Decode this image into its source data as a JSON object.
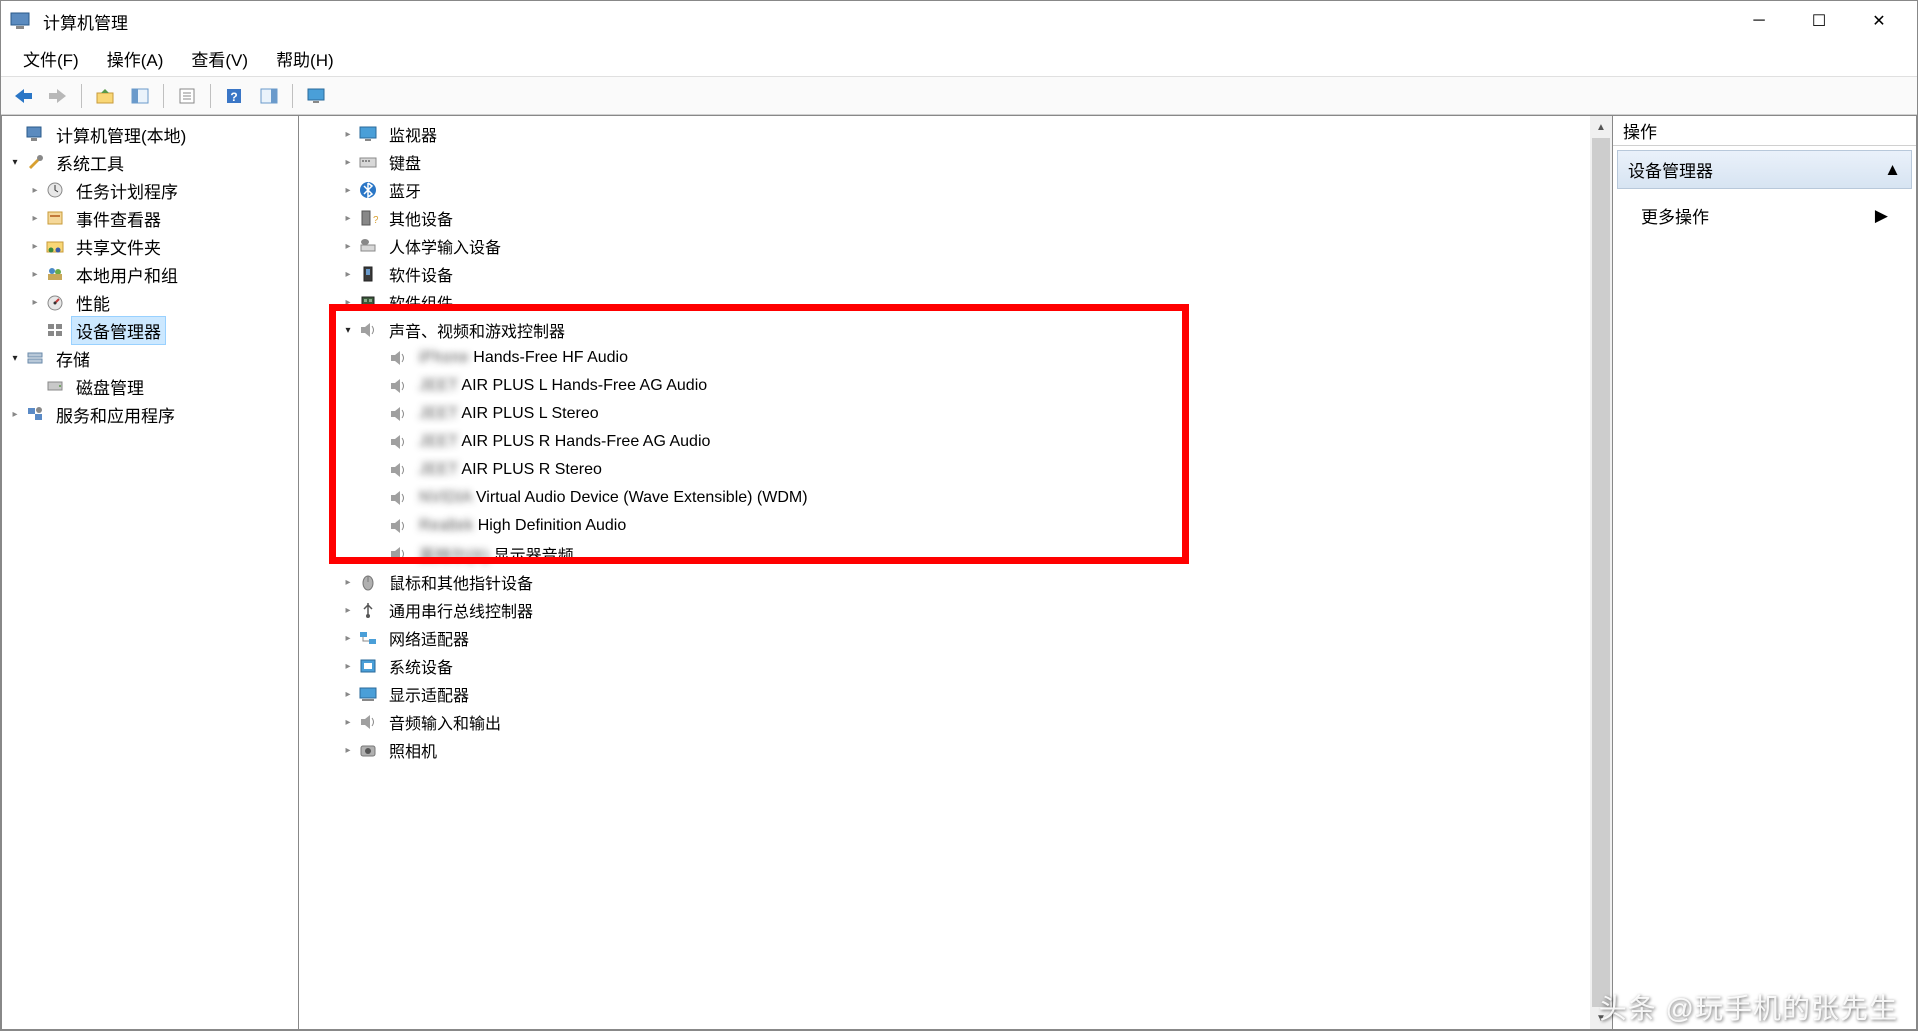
{
  "window": {
    "title": "计算机管理"
  },
  "menu": {
    "file": "文件(F)",
    "action": "操作(A)",
    "view": "查看(V)",
    "help": "帮助(H)"
  },
  "left_tree": {
    "root": "计算机管理(本地)",
    "system_tools": "系统工具",
    "task_scheduler": "任务计划程序",
    "event_viewer": "事件查看器",
    "shared_folders": "共享文件夹",
    "local_users": "本地用户和组",
    "performance": "性能",
    "device_manager": "设备管理器",
    "storage": "存储",
    "disk_management": "磁盘管理",
    "services_apps": "服务和应用程序"
  },
  "devices": {
    "monitor": "监视器",
    "keyboard": "键盘",
    "bluetooth": "蓝牙",
    "other_devices": "其他设备",
    "hid": "人体学输入设备",
    "software_devices": "软件设备",
    "software_components": "软件组件",
    "sound_video_game": "声音、视频和游戏控制器",
    "audio_items": [
      {
        "prefix": "iPhone",
        "label": "Hands-Free HF Audio"
      },
      {
        "prefix": "JEET",
        "label": "AIR PLUS L Hands-Free AG Audio"
      },
      {
        "prefix": "JEET",
        "label": "AIR PLUS L Stereo"
      },
      {
        "prefix": "JEET",
        "label": "AIR PLUS R Hands-Free AG Audio"
      },
      {
        "prefix": "JEET",
        "label": "AIR PLUS R Stereo"
      },
      {
        "prefix": "NVIDIA",
        "label": "Virtual Audio Device (Wave Extensible) (WDM)"
      },
      {
        "prefix": "Realtek",
        "label": "High Definition Audio"
      },
      {
        "prefix": "英特尔(R)",
        "label": "显示器音频"
      }
    ],
    "mouse": "鼠标和其他指针设备",
    "usb": "通用串行总线控制器",
    "network": "网络适配器",
    "system_devices": "系统设备",
    "display": "显示适配器",
    "audio_io": "音频输入和输出",
    "camera": "照相机"
  },
  "actions": {
    "header": "操作",
    "section": "设备管理器",
    "more": "更多操作"
  },
  "watermark": "头条 @玩手机的张先生"
}
